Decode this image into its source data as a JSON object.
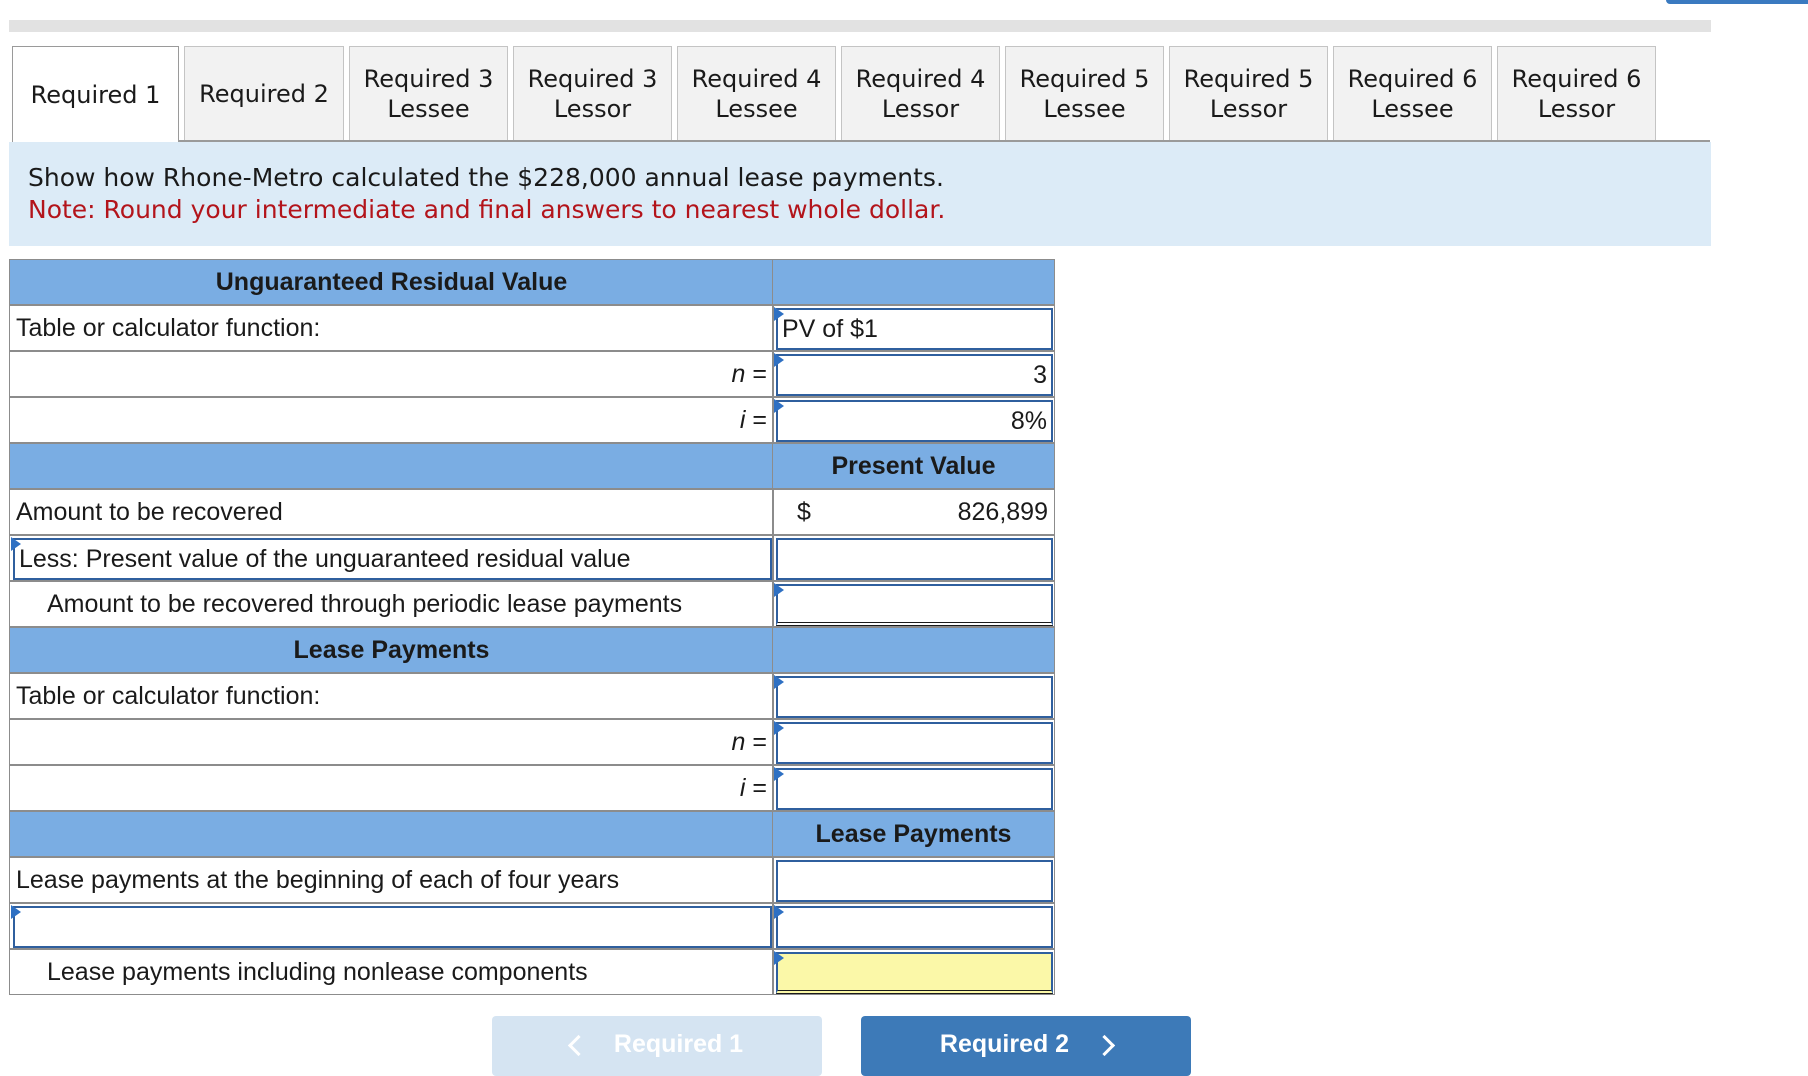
{
  "tabs": [
    {
      "label": "Required 1",
      "active": true
    },
    {
      "label": "Required 2",
      "active": false
    },
    {
      "label": "Required 3\nLessee",
      "active": false
    },
    {
      "label": "Required 3\nLessor",
      "active": false
    },
    {
      "label": "Required 4\nLessee",
      "active": false
    },
    {
      "label": "Required 4\nLessor",
      "active": false
    },
    {
      "label": "Required 5\nLessee",
      "active": false
    },
    {
      "label": "Required 5\nLessor",
      "active": false
    },
    {
      "label": "Required 6\nLessee",
      "active": false
    },
    {
      "label": "Required 6\nLessor",
      "active": false
    }
  ],
  "instructions": {
    "text": "Show how Rhone-Metro calculated the $228,000 annual lease payments.",
    "note": "Note: Round your intermediate and final answers to nearest whole dollar."
  },
  "table": {
    "section1_header": "Unguaranteed Residual Value",
    "table_fn_label": "Table or calculator function:",
    "table_fn_value": "PV of $1",
    "n_label": "n",
    "i_label": "i",
    "eq": " =",
    "n_value": "3",
    "i_value": "8%",
    "pv_header": "Present Value",
    "amount_recovered_label": "Amount to be recovered",
    "currency": "$",
    "amount_recovered_value": "826,899",
    "less_pv_label": "Less: Present value of the unguaranteed residual value",
    "periodic_label": "Amount to be recovered through periodic lease payments",
    "section2_header": "Lease Payments",
    "table_fn_label2": "Table or calculator function:",
    "lp_header": "Lease Payments",
    "lp_beginning_label": "Lease payments at the beginning of each of four years",
    "lp_nonlease_label": "Lease payments including nonlease components"
  },
  "nav": {
    "prev_label": "Required 1",
    "next_label": "Required 2"
  }
}
